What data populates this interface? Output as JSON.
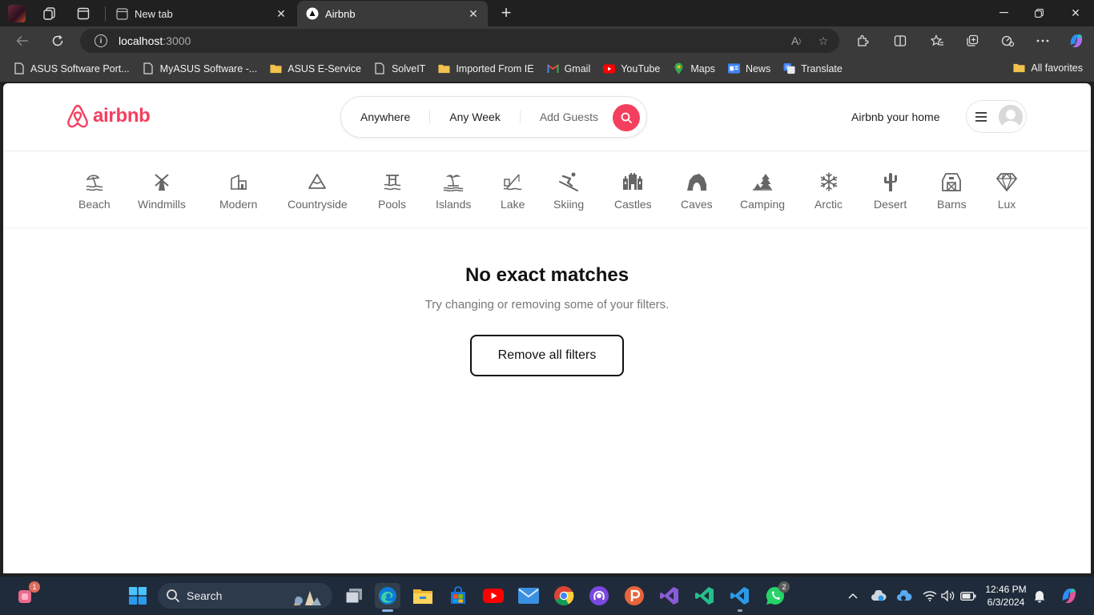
{
  "browser": {
    "tabs": [
      {
        "title": "New tab",
        "active": false
      },
      {
        "title": "Airbnb",
        "active": true
      }
    ],
    "url_host": "localhost",
    "url_port": ":3000",
    "favorites": [
      {
        "label": "ASUS Software Port...",
        "icon": "page-icon"
      },
      {
        "label": "MyASUS Software -...",
        "icon": "page-icon"
      },
      {
        "label": "ASUS E-Service",
        "icon": "folder-icon"
      },
      {
        "label": "SolveIT",
        "icon": "page-icon"
      },
      {
        "label": "Imported From IE",
        "icon": "folder-icon"
      },
      {
        "label": "Gmail",
        "icon": "gmail-icon"
      },
      {
        "label": "YouTube",
        "icon": "youtube-icon"
      },
      {
        "label": "Maps",
        "icon": "maps-icon"
      },
      {
        "label": "News",
        "icon": "news-icon"
      },
      {
        "label": "Translate",
        "icon": "translate-icon"
      }
    ],
    "all_favorites": "All favorites"
  },
  "site": {
    "logo_text": "airbnb",
    "brand_color": "#f43f5e",
    "search": {
      "anywhere": "Anywhere",
      "any_week": "Any Week",
      "add_guests": "Add Guests"
    },
    "host_link": "Airbnb your home",
    "categories": [
      {
        "label": "Beach",
        "icon": "beach-icon"
      },
      {
        "label": "Windmills",
        "icon": "windmill-icon"
      },
      {
        "label": "Modern",
        "icon": "modern-icon"
      },
      {
        "label": "Countryside",
        "icon": "mountain-icon"
      },
      {
        "label": "Pools",
        "icon": "pool-icon"
      },
      {
        "label": "Islands",
        "icon": "island-icon"
      },
      {
        "label": "Lake",
        "icon": "lake-icon"
      },
      {
        "label": "Skiing",
        "icon": "skiing-icon"
      },
      {
        "label": "Castles",
        "icon": "castle-icon"
      },
      {
        "label": "Caves",
        "icon": "cave-icon"
      },
      {
        "label": "Camping",
        "icon": "camping-icon"
      },
      {
        "label": "Arctic",
        "icon": "snowflake-icon"
      },
      {
        "label": "Desert",
        "icon": "cactus-icon"
      },
      {
        "label": "Barns",
        "icon": "barn-icon"
      },
      {
        "label": "Lux",
        "icon": "diamond-icon"
      }
    ],
    "empty_state": {
      "title": "No exact matches",
      "subtitle": "Try changing or removing some of your filters.",
      "button": "Remove all filters"
    }
  },
  "taskbar": {
    "search_label": "Search",
    "notification_badge": "1",
    "whatsapp_badge": "2",
    "time": "12:46 PM",
    "date": "6/3/2024"
  }
}
